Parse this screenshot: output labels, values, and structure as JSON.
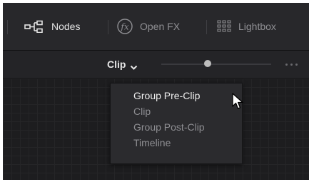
{
  "toolbar": {
    "nodes": {
      "label": "Nodes",
      "icon": "node-graph-icon",
      "color": "#e3e3e3"
    },
    "openfx": {
      "label": "Open FX",
      "icon": "fx-icon",
      "color": "#8f8f93"
    },
    "lightbox": {
      "label": "Lightbox",
      "icon": "grid-icon",
      "color": "#8f8f93"
    }
  },
  "subbar": {
    "mode_label": "Clip",
    "mode_icon": "chevron-down-icon",
    "more_icon": "more-dots-icon",
    "slider_level": 0.4
  },
  "dropdown": {
    "items": [
      {
        "label": "Group Pre-Clip",
        "state": "hovered",
        "color": "#eeeeee"
      },
      {
        "label": "Clip",
        "state": "normal",
        "color": "#8e8e92"
      },
      {
        "label": "Group Post-Clip",
        "state": "normal",
        "color": "#8e8e92"
      },
      {
        "label": "Timeline",
        "state": "normal",
        "color": "#8e8e92"
      }
    ]
  },
  "cursor_icon": "mouse-pointer-icon"
}
